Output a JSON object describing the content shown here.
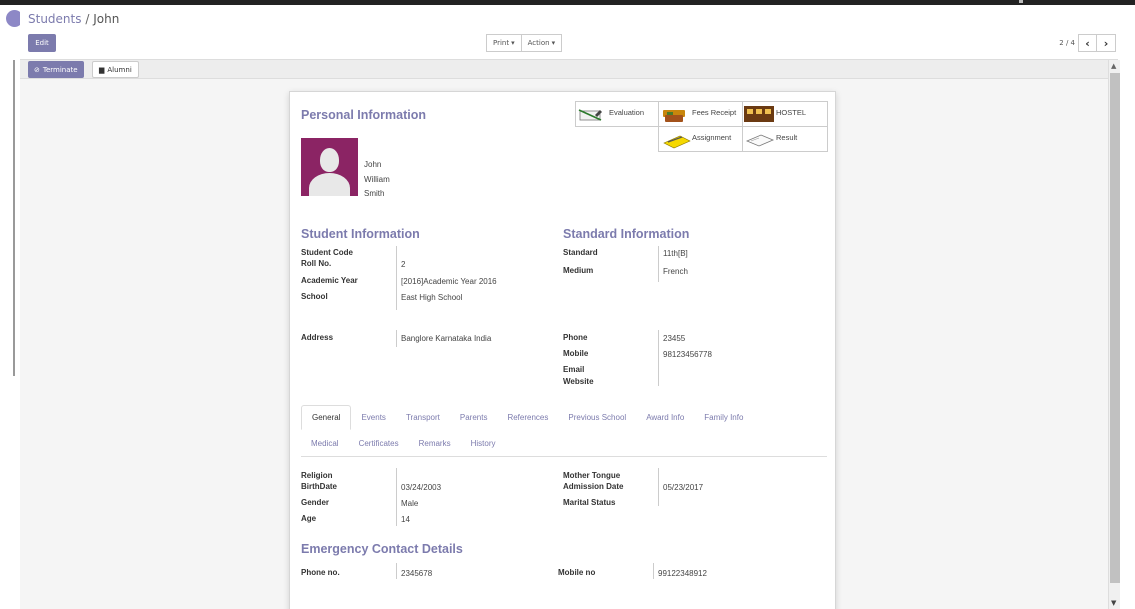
{
  "breadcrumb": {
    "parent": "Students",
    "separator": "/",
    "current": "John"
  },
  "control": {
    "edit_label": "Edit",
    "print_label": "Print",
    "action_label": "Action",
    "pager_text": "2 / 4"
  },
  "statusbar": {
    "terminate_label": "Terminate",
    "alumni_label": "Alumni"
  },
  "smart_buttons": [
    {
      "label": "Evaluation",
      "icon": "evaluation-icon"
    },
    {
      "label": "Fees Receipt",
      "icon": "fees-receipt-icon"
    },
    {
      "label": "HOSTEL",
      "icon": "hostel-icon"
    },
    {
      "label": "Assignment",
      "icon": "assignment-icon"
    },
    {
      "label": "Result",
      "icon": "result-icon"
    }
  ],
  "personal": {
    "title": "Personal Information",
    "first_name": "John",
    "middle_name": "William",
    "last_name": "Smith"
  },
  "student_info": {
    "title": "Student Information",
    "student_code_label": "Student Code",
    "student_code": "",
    "roll_no_label": "Roll No.",
    "roll_no": "2",
    "academic_year_label": "Academic Year",
    "academic_year": "[2016]Academic Year 2016",
    "school_label": "School",
    "school": "East High School"
  },
  "standard_info": {
    "title": "Standard Information",
    "standard_label": "Standard",
    "standard": "11th[B]",
    "medium_label": "Medium",
    "medium": "French"
  },
  "contact": {
    "address_label": "Address",
    "address": "Banglore Karnataka India",
    "phone_label": "Phone",
    "phone": "23455",
    "mobile_label": "Mobile",
    "mobile": "98123456778",
    "email_label": "Email",
    "website_label": "Website"
  },
  "tabs": {
    "row1": [
      "General",
      "Events",
      "Transport",
      "Parents",
      "References",
      "Previous School",
      "Award Info",
      "Family Info"
    ],
    "row2": [
      "Medical",
      "Certificates",
      "Remarks",
      "History"
    ],
    "active": "General"
  },
  "general": {
    "religion_label": "Religion",
    "birthdate_label": "BirthDate",
    "birthdate": "03/24/2003",
    "gender_label": "Gender",
    "gender": "Male",
    "age_label": "Age",
    "age": "14",
    "mother_tongue_label": "Mother Tongue",
    "admission_date_label": "Admission Date",
    "admission_date": "05/23/2017",
    "marital_status_label": "Marital Status"
  },
  "emergency": {
    "title": "Emergency Contact Details",
    "phone_label": "Phone no.",
    "phone": "2345678",
    "mobile_label": "Mobile no",
    "mobile": "99122348912"
  },
  "colors": {
    "accent": "#7c7bad",
    "photo_bg": "#8b2464"
  }
}
